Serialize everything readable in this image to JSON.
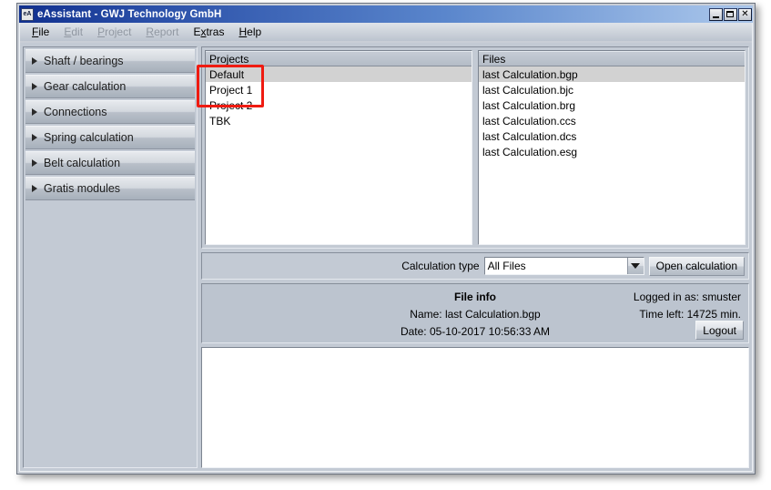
{
  "window": {
    "title": "eAssistant - GWJ Technology GmbH",
    "icon_label": "eA",
    "buttons": {
      "minimize": "minimize-icon",
      "maximize": "maximize-icon",
      "close": "✕"
    }
  },
  "menubar": {
    "items": [
      {
        "label": "File",
        "mnemonic": "F",
        "enabled": true
      },
      {
        "label": "Edit",
        "mnemonic": "E",
        "enabled": false
      },
      {
        "label": "Project",
        "mnemonic": "P",
        "enabled": false
      },
      {
        "label": "Report",
        "mnemonic": "R",
        "enabled": false
      },
      {
        "label": "Extras",
        "mnemonic": "x",
        "enabled": true
      },
      {
        "label": "Help",
        "mnemonic": "H",
        "enabled": true
      }
    ]
  },
  "sidebar": {
    "items": [
      {
        "label": "Shaft / bearings"
      },
      {
        "label": "Gear calculation"
      },
      {
        "label": "Connections"
      },
      {
        "label": "Spring calculation"
      },
      {
        "label": "Belt calculation"
      },
      {
        "label": "Gratis modules"
      }
    ]
  },
  "projects_list": {
    "header": "Projects",
    "items": [
      {
        "label": "Default",
        "selected": true
      },
      {
        "label": "Project 1",
        "selected": false
      },
      {
        "label": "Project 2",
        "selected": false
      },
      {
        "label": "TBK",
        "selected": false
      }
    ]
  },
  "files_list": {
    "header": "Files",
    "items": [
      {
        "label": "last Calculation.bgp",
        "selected": true
      },
      {
        "label": "last Calculation.bjc",
        "selected": false
      },
      {
        "label": "last Calculation.brg",
        "selected": false
      },
      {
        "label": "last Calculation.ccs",
        "selected": false
      },
      {
        "label": "last Calculation.dcs",
        "selected": false
      },
      {
        "label": "last Calculation.esg",
        "selected": false
      }
    ]
  },
  "calculation_type": {
    "label": "Calculation type",
    "selected_value": "All Files",
    "open_button": "Open calculation"
  },
  "file_info": {
    "title": "File info",
    "name": "Name: last Calculation.bgp",
    "date": "Date: 05-10-2017 10:56:33 AM",
    "logged_in": "Logged in as: smuster",
    "time_left": "Time left: 14725 min.",
    "logout_button": "Logout"
  },
  "annotation": {
    "color": "#ef1b11",
    "shape": "rectangle"
  }
}
